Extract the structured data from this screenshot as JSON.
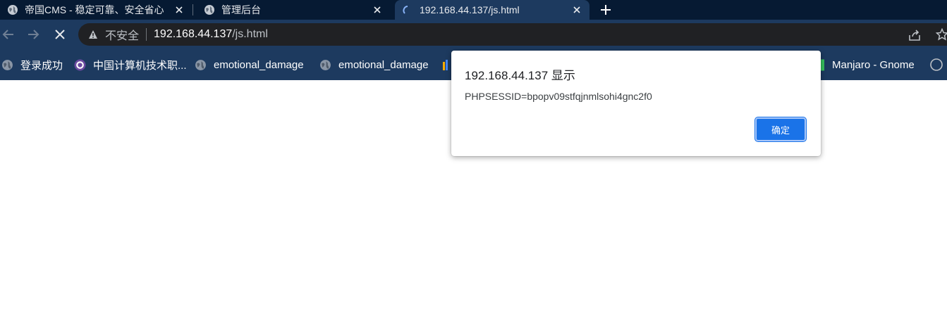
{
  "tabs": [
    {
      "label": "帝国CMS - 稳定可靠、安全省心",
      "icon": "globe-icon"
    },
    {
      "label": "管理后台",
      "icon": "globe-icon"
    },
    {
      "label": "192.168.44.137/js.html",
      "icon": "loading-spinner-icon"
    }
  ],
  "address": {
    "security_label": "不安全",
    "host": "192.168.44.137",
    "path": "/js.html"
  },
  "bookmarks": [
    {
      "label": "登录成功",
      "icon": "globe-icon"
    },
    {
      "label": "中国计算机技术职...",
      "icon": "site-logo-icon"
    },
    {
      "label": "emotional_damage",
      "icon": "globe-icon"
    },
    {
      "label": "emotional_damage",
      "icon": "globe-icon"
    },
    {
      "label": "Manjaro - Gnome",
      "icon": "bookmark-favicon-icon"
    }
  ],
  "dialog": {
    "title": "192.168.44.137 显示",
    "message": "PHPSESSID=bpopv09stfqjnmlsohi4gnc2f0",
    "ok_label": "确定"
  },
  "colors": {
    "tabstrip_bg": "#061a33",
    "toolbar_bg": "#1d3a5f",
    "omnibox_bg": "#202124",
    "accent": "#1a73e8"
  }
}
